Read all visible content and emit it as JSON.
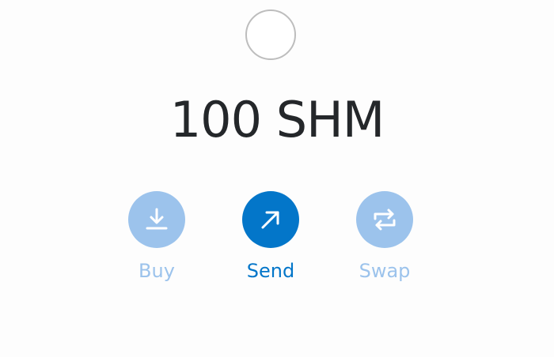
{
  "token": {
    "balance_display": "100 SHM"
  },
  "actions": {
    "buy": {
      "label": "Buy",
      "icon": "download-icon",
      "state": "disabled"
    },
    "send": {
      "label": "Send",
      "icon": "arrow-up-right-icon",
      "state": "active"
    },
    "swap": {
      "label": "Swap",
      "icon": "swap-arrows-icon",
      "state": "disabled"
    }
  },
  "colors": {
    "primary": "#0376c9",
    "disabled": "#9cc3ec",
    "text": "#24272a",
    "avatar_border": "#bdbdbd",
    "background": "#fdfdfd"
  }
}
